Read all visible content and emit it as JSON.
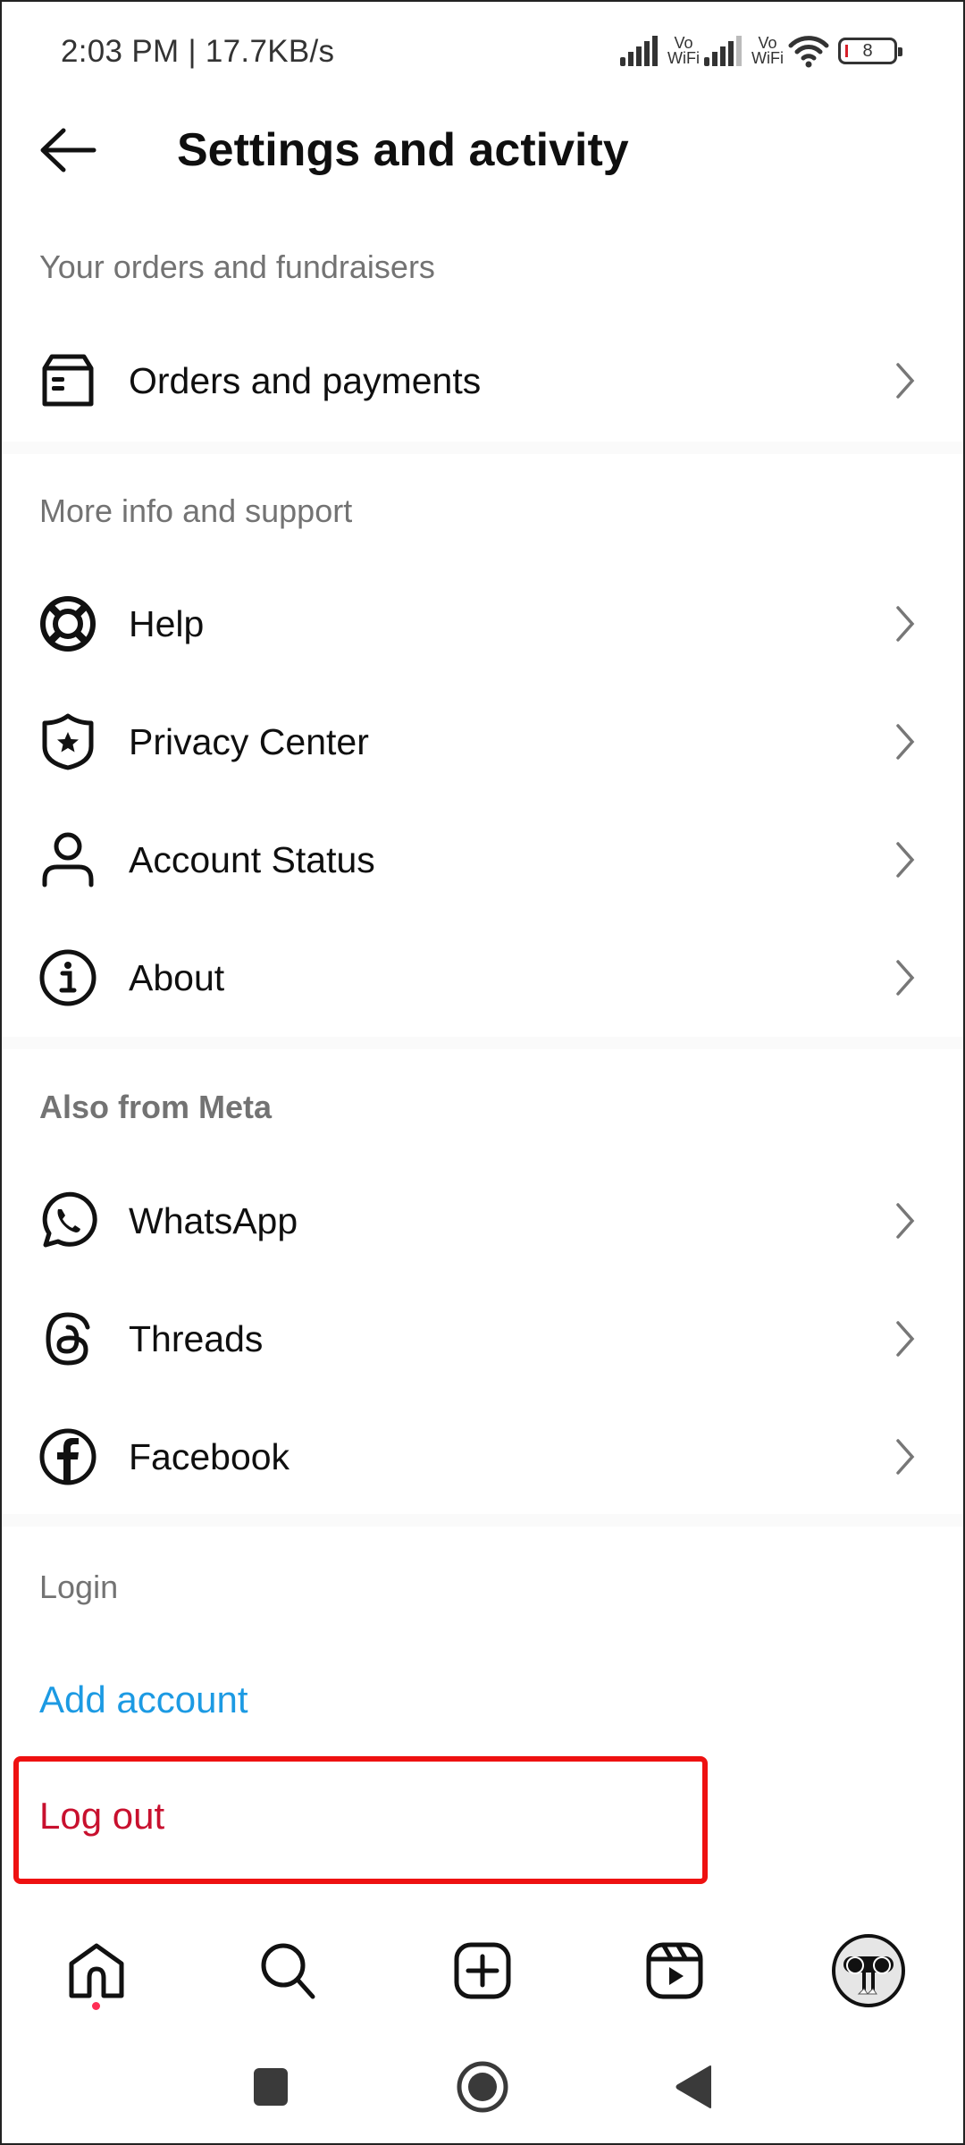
{
  "status_bar": {
    "time_speed": "2:03 PM | 17.7KB/s",
    "sim1_label_top": "Vo",
    "sim1_label_bottom": "WiFi",
    "sim2_label_top": "Vo",
    "sim2_label_bottom": "WiFi",
    "battery_level": "8",
    "icons": [
      "signal-icon",
      "vowifi-icon",
      "signal-icon",
      "vowifi-icon",
      "wifi-icon",
      "battery-icon"
    ]
  },
  "header": {
    "title": "Settings and activity",
    "back_icon": "arrow-left-icon"
  },
  "sections": [
    {
      "title": "Your orders and fundraisers",
      "items": [
        {
          "label": "Orders and payments",
          "icon": "box-icon"
        }
      ]
    },
    {
      "title": "More info and support",
      "items": [
        {
          "label": "Help",
          "icon": "lifebuoy-icon"
        },
        {
          "label": "Privacy Center",
          "icon": "shield-star-icon"
        },
        {
          "label": "Account Status",
          "icon": "person-icon"
        },
        {
          "label": "About",
          "icon": "info-icon"
        }
      ]
    },
    {
      "title": "Also from Meta",
      "items": [
        {
          "label": "WhatsApp",
          "icon": "whatsapp-icon"
        },
        {
          "label": "Threads",
          "icon": "threads-icon"
        },
        {
          "label": "Facebook",
          "icon": "facebook-icon"
        }
      ]
    },
    {
      "title": "Login",
      "items": [
        {
          "label": "Add account"
        },
        {
          "label": "Log out"
        }
      ]
    }
  ],
  "colors": {
    "link_blue": "#1c9ae3",
    "logout_red": "#c8102e",
    "highlight_red": "#ee1111",
    "section_gray": "#737373",
    "notification_dot": "#ff2d55"
  },
  "bottom_nav": {
    "items": [
      "home-icon",
      "search-icon",
      "create-icon",
      "reels-icon",
      "profile-avatar"
    ],
    "home_has_notification": true
  },
  "system_nav": {
    "items": [
      "recents-icon",
      "home-circle-icon",
      "back-triangle-icon"
    ]
  }
}
